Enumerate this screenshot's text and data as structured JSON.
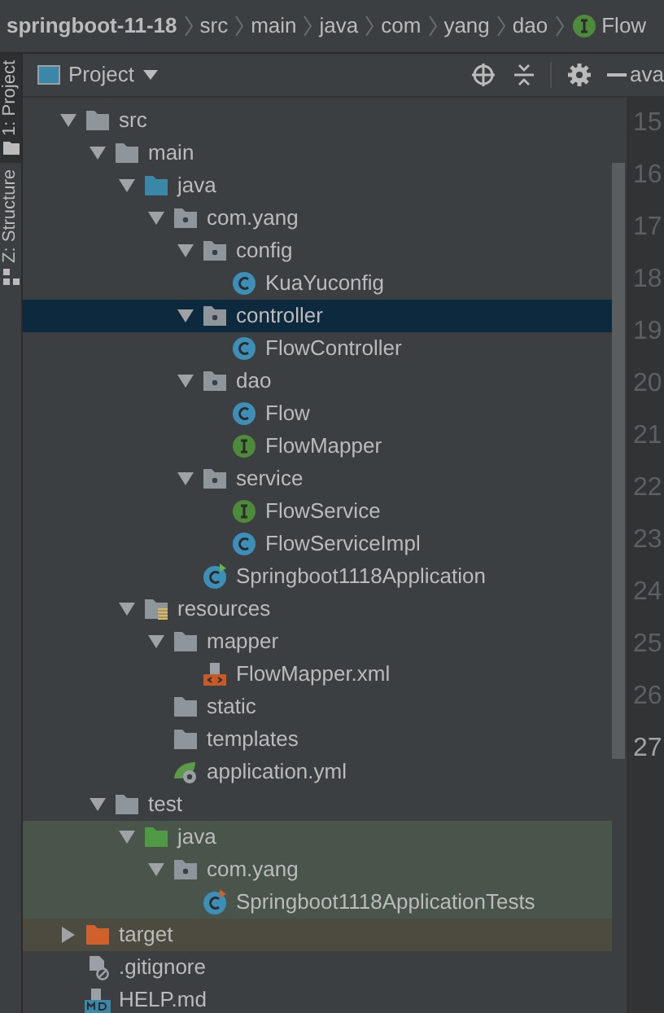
{
  "breadcrumb": [
    {
      "label": "springboot-11-18",
      "kind": "project"
    },
    {
      "label": "src",
      "kind": "folder"
    },
    {
      "label": "main",
      "kind": "folder"
    },
    {
      "label": "java",
      "kind": "folder"
    },
    {
      "label": "com",
      "kind": "folder"
    },
    {
      "label": "yang",
      "kind": "folder"
    },
    {
      "label": "dao",
      "kind": "folder"
    },
    {
      "label": "Flow",
      "kind": "interface"
    }
  ],
  "tool_strip": [
    {
      "label": "1: Project",
      "selected": true
    },
    {
      "label": "Z: Structure",
      "selected": false
    }
  ],
  "panel": {
    "title": "Project"
  },
  "editor_tab": {
    "label": "ava"
  },
  "tree": [
    {
      "label": "src",
      "kind": "folder",
      "expanded": true,
      "selected": false,
      "children": [
        {
          "label": "main",
          "kind": "folder",
          "expanded": true,
          "selected": false,
          "children": [
            {
              "label": "java",
              "kind": "source",
              "expanded": true,
              "selected": false,
              "children": [
                {
                  "label": "com.yang",
                  "kind": "package",
                  "expanded": true,
                  "selected": false,
                  "children": [
                    {
                      "label": "config",
                      "kind": "package",
                      "expanded": true,
                      "selected": false,
                      "children": [
                        {
                          "label": "KuaYuconfig",
                          "kind": "class",
                          "selected": false
                        }
                      ]
                    },
                    {
                      "label": "controller",
                      "kind": "package",
                      "expanded": true,
                      "selected": true,
                      "children": [
                        {
                          "label": "FlowController",
                          "kind": "class",
                          "selected": false
                        }
                      ]
                    },
                    {
                      "label": "dao",
                      "kind": "package",
                      "expanded": true,
                      "selected": false,
                      "children": [
                        {
                          "label": "Flow",
                          "kind": "class",
                          "selected": false
                        },
                        {
                          "label": "FlowMapper",
                          "kind": "interface",
                          "selected": false
                        }
                      ]
                    },
                    {
                      "label": "service",
                      "kind": "package",
                      "expanded": true,
                      "selected": false,
                      "children": [
                        {
                          "label": "FlowService",
                          "kind": "interface",
                          "selected": false
                        },
                        {
                          "label": "FlowServiceImpl",
                          "kind": "class",
                          "selected": false
                        }
                      ]
                    },
                    {
                      "label": "Springboot1118Application",
                      "kind": "spring",
                      "selected": false
                    }
                  ]
                }
              ]
            },
            {
              "label": "resources",
              "kind": "resources",
              "expanded": true,
              "selected": false,
              "children": [
                {
                  "label": "mapper",
                  "kind": "folder",
                  "expanded": true,
                  "selected": false,
                  "children": [
                    {
                      "label": "FlowMapper.xml",
                      "kind": "xml",
                      "selected": false
                    }
                  ]
                },
                {
                  "label": "static",
                  "kind": "folder",
                  "selected": false
                },
                {
                  "label": "templates",
                  "kind": "folder",
                  "selected": false
                },
                {
                  "label": "application.yml",
                  "kind": "yml",
                  "selected": false
                }
              ]
            }
          ]
        },
        {
          "label": "test",
          "kind": "folder",
          "expanded": true,
          "selected": false,
          "children": [
            {
              "label": "java",
              "kind": "testsource",
              "expanded": true,
              "selected": false,
              "color": "#49544a",
              "children": [
                {
                  "label": "com.yang",
                  "kind": "package",
                  "expanded": true,
                  "selected": false,
                  "color": "#49544a",
                  "children": [
                    {
                      "label": "Springboot1118ApplicationTests",
                      "kind": "testclass",
                      "selected": false,
                      "color": "#49544a"
                    }
                  ]
                }
              ]
            }
          ]
        }
      ]
    },
    {
      "label": "target",
      "kind": "excluded",
      "expanded": false,
      "selected": false,
      "color": "#4d4a3f"
    },
    {
      "label": ".gitignore",
      "kind": "ignore",
      "selected": false
    },
    {
      "label": "HELP.md",
      "kind": "md",
      "selected": false
    }
  ],
  "line_numbers": [
    {
      "label": "15",
      "current": false
    },
    {
      "label": "16",
      "current": false
    },
    {
      "label": "17",
      "current": false
    },
    {
      "label": "18",
      "current": false
    },
    {
      "label": "19",
      "current": false
    },
    {
      "label": "20",
      "current": false
    },
    {
      "label": "21",
      "current": false
    },
    {
      "label": "22",
      "current": false
    },
    {
      "label": "23",
      "current": false
    },
    {
      "label": "24",
      "current": false
    },
    {
      "label": "25",
      "current": false
    },
    {
      "label": "26",
      "current": false
    },
    {
      "label": "27",
      "current": true
    }
  ]
}
